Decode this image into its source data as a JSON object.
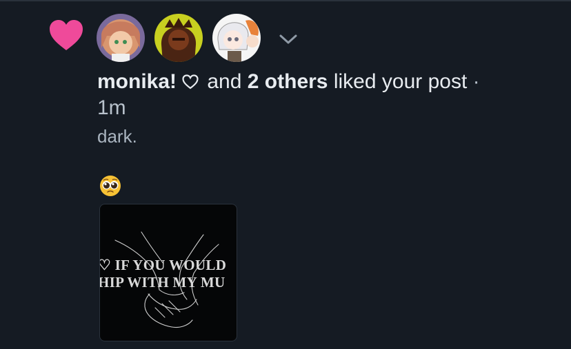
{
  "notification": {
    "user": "monika!",
    "connector": "and",
    "others": "2 others",
    "action": "liked your post",
    "separator": "·",
    "timestamp": "1m"
  },
  "post": {
    "text": "dark.",
    "emoji": "pleading-face-emoji",
    "image_lines": [
      "♡ IF YOU WOULD",
      "HIP WITH MY MU"
    ]
  },
  "colors": {
    "background": "#151b23",
    "like_heart": "#ef4a9a",
    "text_primary": "#e8ecf0",
    "text_secondary": "#aab5c0"
  },
  "icons": [
    "heart-icon",
    "chevron-down-icon",
    "outline-heart-icon"
  ]
}
